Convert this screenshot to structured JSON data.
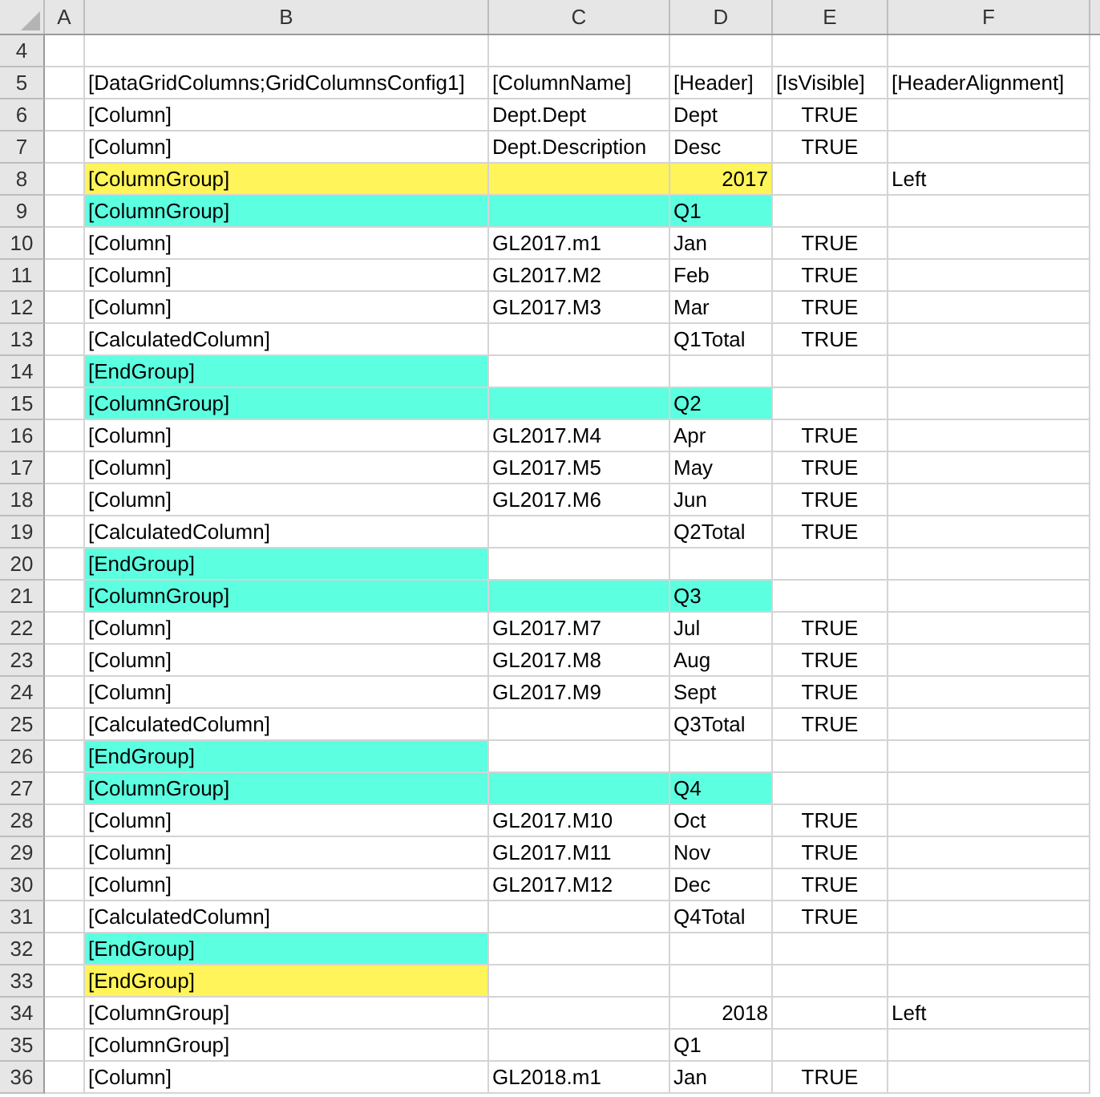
{
  "columns": [
    "A",
    "B",
    "C",
    "D",
    "E",
    "F"
  ],
  "rows": [
    {
      "number": "4",
      "cells": [
        {},
        {},
        {},
        {},
        {},
        {}
      ]
    },
    {
      "number": "5",
      "cells": [
        {},
        {
          "text": "[DataGridColumns;GridColumnsConfig1]"
        },
        {
          "text": "[ColumnName]"
        },
        {
          "text": "[Header]"
        },
        {
          "text": "[IsVisible]"
        },
        {
          "text": "[HeaderAlignment]"
        }
      ]
    },
    {
      "number": "6",
      "cells": [
        {},
        {
          "text": "[Column]"
        },
        {
          "text": "Dept.Dept"
        },
        {
          "text": "Dept"
        },
        {
          "text": "TRUE",
          "kind": "boolean"
        },
        {}
      ]
    },
    {
      "number": "7",
      "cells": [
        {},
        {
          "text": "[Column]"
        },
        {
          "text": "Dept.Description"
        },
        {
          "text": "Desc"
        },
        {
          "text": "TRUE",
          "kind": "boolean"
        },
        {}
      ]
    },
    {
      "number": "8",
      "cells": [
        {},
        {
          "text": "[ColumnGroup]",
          "color": "#fff45a"
        },
        {
          "color": "#fff45a"
        },
        {
          "text": "2017",
          "kind": "number",
          "color": "#fff45a"
        },
        {},
        {
          "text": "Left"
        }
      ]
    },
    {
      "number": "9",
      "cells": [
        {},
        {
          "text": "[ColumnGroup]",
          "color": "#5cffe0"
        },
        {
          "color": "#5cffe0"
        },
        {
          "text": "Q1",
          "color": "#5cffe0"
        },
        {},
        {}
      ]
    },
    {
      "number": "10",
      "cells": [
        {},
        {
          "text": "[Column]"
        },
        {
          "text": "GL2017.m1"
        },
        {
          "text": "Jan"
        },
        {
          "text": "TRUE",
          "kind": "boolean"
        },
        {}
      ]
    },
    {
      "number": "11",
      "cells": [
        {},
        {
          "text": "[Column]"
        },
        {
          "text": "GL2017.M2"
        },
        {
          "text": "Feb"
        },
        {
          "text": "TRUE",
          "kind": "boolean"
        },
        {}
      ]
    },
    {
      "number": "12",
      "cells": [
        {},
        {
          "text": "[Column]"
        },
        {
          "text": "GL2017.M3"
        },
        {
          "text": "Mar"
        },
        {
          "text": "TRUE",
          "kind": "boolean"
        },
        {}
      ]
    },
    {
      "number": "13",
      "cells": [
        {},
        {
          "text": "[CalculatedColumn]"
        },
        {},
        {
          "text": "Q1Total"
        },
        {
          "text": "TRUE",
          "kind": "boolean"
        },
        {}
      ]
    },
    {
      "number": "14",
      "cells": [
        {},
        {
          "text": "[EndGroup]",
          "color": "#5cffe0"
        },
        {},
        {},
        {},
        {}
      ]
    },
    {
      "number": "15",
      "cells": [
        {},
        {
          "text": "[ColumnGroup]",
          "color": "#5cffe0"
        },
        {
          "color": "#5cffe0"
        },
        {
          "text": "Q2",
          "color": "#5cffe0"
        },
        {},
        {}
      ]
    },
    {
      "number": "16",
      "cells": [
        {},
        {
          "text": "[Column]"
        },
        {
          "text": "GL2017.M4"
        },
        {
          "text": "Apr"
        },
        {
          "text": "TRUE",
          "kind": "boolean"
        },
        {}
      ]
    },
    {
      "number": "17",
      "cells": [
        {},
        {
          "text": "[Column]"
        },
        {
          "text": "GL2017.M5"
        },
        {
          "text": "May"
        },
        {
          "text": "TRUE",
          "kind": "boolean"
        },
        {}
      ]
    },
    {
      "number": "18",
      "cells": [
        {},
        {
          "text": "[Column]"
        },
        {
          "text": "GL2017.M6"
        },
        {
          "text": "Jun"
        },
        {
          "text": "TRUE",
          "kind": "boolean"
        },
        {}
      ]
    },
    {
      "number": "19",
      "cells": [
        {},
        {
          "text": "[CalculatedColumn]"
        },
        {},
        {
          "text": "Q2Total"
        },
        {
          "text": "TRUE",
          "kind": "boolean"
        },
        {}
      ]
    },
    {
      "number": "20",
      "cells": [
        {},
        {
          "text": "[EndGroup]",
          "color": "#5cffe0"
        },
        {},
        {},
        {},
        {}
      ]
    },
    {
      "number": "21",
      "cells": [
        {},
        {
          "text": "[ColumnGroup]",
          "color": "#5cffe0"
        },
        {
          "color": "#5cffe0"
        },
        {
          "text": "Q3",
          "color": "#5cffe0"
        },
        {},
        {}
      ]
    },
    {
      "number": "22",
      "cells": [
        {},
        {
          "text": "[Column]"
        },
        {
          "text": "GL2017.M7"
        },
        {
          "text": "Jul"
        },
        {
          "text": "TRUE",
          "kind": "boolean"
        },
        {}
      ]
    },
    {
      "number": "23",
      "cells": [
        {},
        {
          "text": "[Column]"
        },
        {
          "text": "GL2017.M8"
        },
        {
          "text": "Aug"
        },
        {
          "text": "TRUE",
          "kind": "boolean"
        },
        {}
      ]
    },
    {
      "number": "24",
      "cells": [
        {},
        {
          "text": "[Column]"
        },
        {
          "text": "GL2017.M9"
        },
        {
          "text": "Sept"
        },
        {
          "text": "TRUE",
          "kind": "boolean"
        },
        {}
      ]
    },
    {
      "number": "25",
      "cells": [
        {},
        {
          "text": "[CalculatedColumn]"
        },
        {},
        {
          "text": "Q3Total"
        },
        {
          "text": "TRUE",
          "kind": "boolean"
        },
        {}
      ]
    },
    {
      "number": "26",
      "cells": [
        {},
        {
          "text": "[EndGroup]",
          "color": "#5cffe0"
        },
        {},
        {},
        {},
        {}
      ]
    },
    {
      "number": "27",
      "cells": [
        {},
        {
          "text": "[ColumnGroup]",
          "color": "#5cffe0"
        },
        {
          "color": "#5cffe0"
        },
        {
          "text": "Q4",
          "color": "#5cffe0"
        },
        {},
        {}
      ]
    },
    {
      "number": "28",
      "cells": [
        {},
        {
          "text": "[Column]"
        },
        {
          "text": "GL2017.M10"
        },
        {
          "text": "Oct"
        },
        {
          "text": "TRUE",
          "kind": "boolean"
        },
        {}
      ]
    },
    {
      "number": "29",
      "cells": [
        {},
        {
          "text": "[Column]"
        },
        {
          "text": "GL2017.M11"
        },
        {
          "text": "Nov"
        },
        {
          "text": "TRUE",
          "kind": "boolean"
        },
        {}
      ]
    },
    {
      "number": "30",
      "cells": [
        {},
        {
          "text": "[Column]"
        },
        {
          "text": "GL2017.M12"
        },
        {
          "text": "Dec"
        },
        {
          "text": "TRUE",
          "kind": "boolean"
        },
        {}
      ]
    },
    {
      "number": "31",
      "cells": [
        {},
        {
          "text": "[CalculatedColumn]"
        },
        {},
        {
          "text": "Q4Total"
        },
        {
          "text": "TRUE",
          "kind": "boolean"
        },
        {}
      ]
    },
    {
      "number": "32",
      "cells": [
        {},
        {
          "text": "[EndGroup]",
          "color": "#5cffe0"
        },
        {},
        {},
        {},
        {}
      ]
    },
    {
      "number": "33",
      "cells": [
        {},
        {
          "text": "[EndGroup]",
          "color": "#fff45a"
        },
        {},
        {},
        {},
        {}
      ]
    },
    {
      "number": "34",
      "cells": [
        {},
        {
          "text": "[ColumnGroup]"
        },
        {},
        {
          "text": "2018",
          "kind": "number"
        },
        {},
        {
          "text": "Left"
        }
      ]
    },
    {
      "number": "35",
      "cells": [
        {},
        {
          "text": "[ColumnGroup]"
        },
        {},
        {
          "text": "Q1"
        },
        {},
        {}
      ]
    },
    {
      "number": "36",
      "cells": [
        {},
        {
          "text": "[Column]"
        },
        {
          "text": "GL2018.m1"
        },
        {
          "text": "Jan"
        },
        {
          "text": "TRUE",
          "kind": "boolean"
        },
        {}
      ]
    }
  ]
}
